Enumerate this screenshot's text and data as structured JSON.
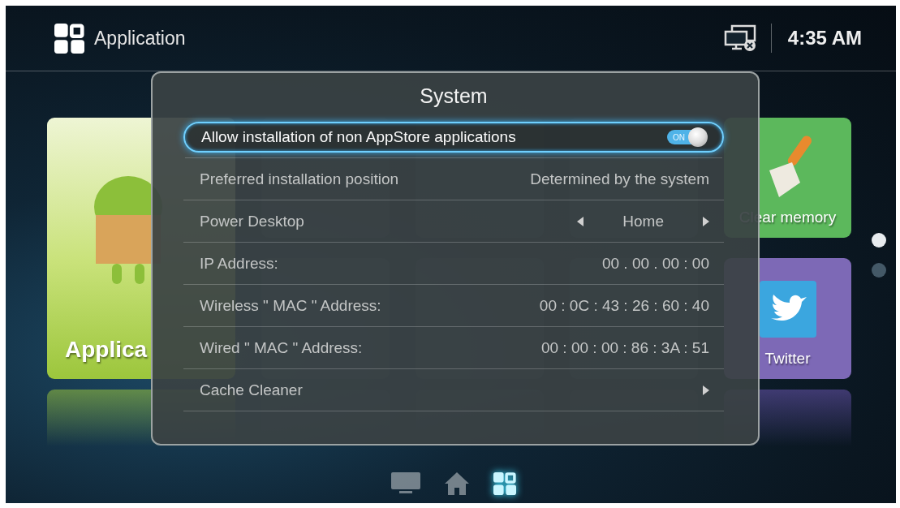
{
  "header": {
    "title": "Application",
    "time": "4:35 AM"
  },
  "tiles": [
    {
      "kind": "large",
      "label": "Applica"
    },
    {
      "kind": "blank"
    },
    {
      "kind": "blank"
    },
    {
      "kind": "blank"
    },
    {
      "kind": "clean",
      "label": "Clear memory"
    },
    {
      "kind": "blank"
    },
    {
      "kind": "blank"
    },
    {
      "kind": "blank"
    },
    {
      "kind": "twitter",
      "label": "Twitter"
    }
  ],
  "page_dots": [
    {
      "selected": true
    },
    {
      "selected": false
    }
  ],
  "dialog": {
    "title": "System",
    "rows": [
      {
        "kind": "toggle",
        "label": "Allow installation of non AppStore applications",
        "on": true,
        "toggle_text": "ON",
        "selected": true
      },
      {
        "kind": "value",
        "label": "Preferred installation position",
        "value": "Determined by the system",
        "selected": false
      },
      {
        "kind": "choice",
        "label": "Power Desktop",
        "value": "Home",
        "selected": false
      },
      {
        "kind": "value",
        "label": "IP Address:",
        "value": "00 . 00 . 00 : 00",
        "selected": false
      },
      {
        "kind": "value",
        "label": "Wireless \" MAC \" Address:",
        "value": "00 : 0C : 43 : 26 : 60 : 40",
        "selected": false
      },
      {
        "kind": "value",
        "label": "Wired \" MAC \" Address:",
        "value": "00 : 00 : 00 : 86 : 3A : 51",
        "selected": false
      },
      {
        "kind": "link",
        "label": "Cache Cleaner",
        "selected": false
      }
    ]
  },
  "nav": [
    {
      "kind": "tv",
      "selected": false
    },
    {
      "kind": "home",
      "selected": false
    },
    {
      "kind": "apps",
      "selected": true
    }
  ]
}
